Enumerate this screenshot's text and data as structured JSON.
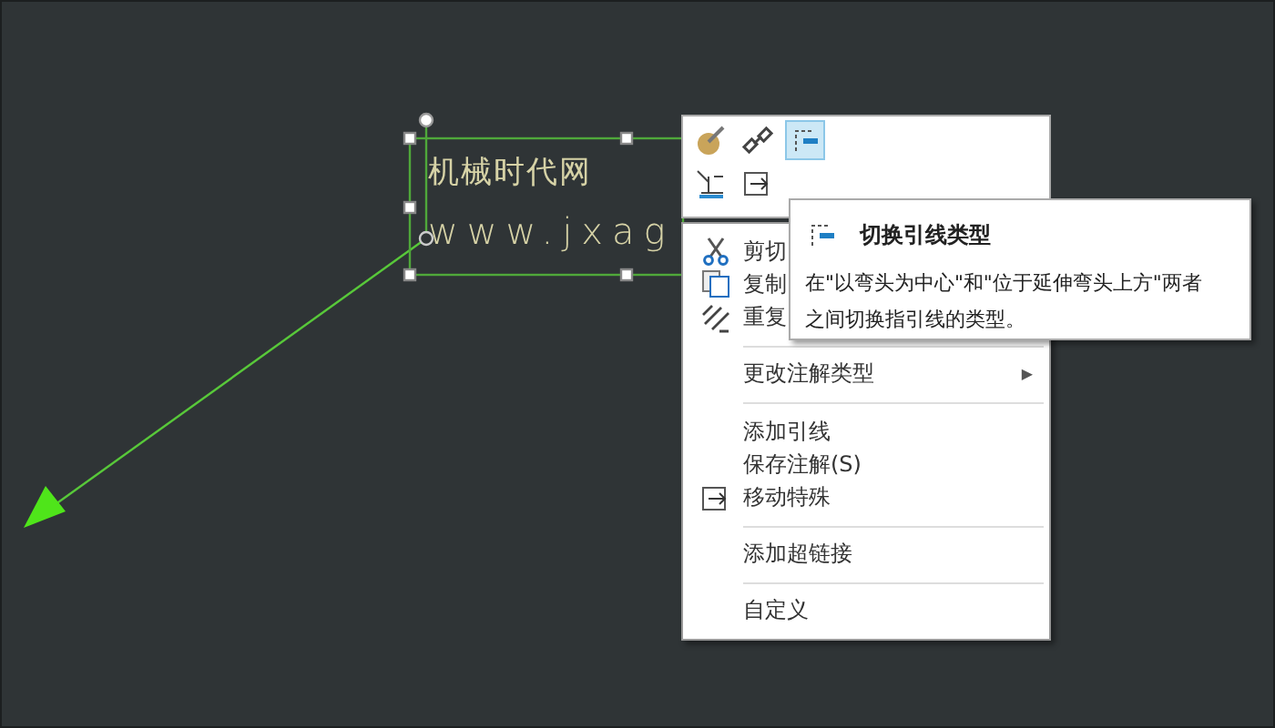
{
  "annotation": {
    "lines": [
      "机械时代网",
      "www.jxag"
    ]
  },
  "mini_toolbar": {
    "rows": [
      [
        {
          "selected": false
        },
        {
          "selected": false
        },
        {
          "selected": true
        }
      ],
      [
        {
          "selected": false
        },
        {
          "selected": false
        }
      ]
    ]
  },
  "context_menu": {
    "items": [
      {
        "kind": "item",
        "label": "剪切"
      },
      {
        "kind": "item",
        "label": "复制"
      },
      {
        "kind": "item",
        "label": "重复"
      },
      {
        "kind": "separator"
      },
      {
        "kind": "item",
        "label": "更改注解类型",
        "arrow": "▶"
      },
      {
        "kind": "separator"
      },
      {
        "kind": "item",
        "label": "添加引线"
      },
      {
        "kind": "item",
        "label": "保存注解(S)"
      },
      {
        "kind": "item",
        "label": "移动特殊"
      },
      {
        "kind": "separator"
      },
      {
        "kind": "item",
        "label": "添加超链接"
      },
      {
        "kind": "separator"
      },
      {
        "kind": "item",
        "label": "自定义"
      }
    ]
  },
  "tooltip": {
    "title": "切换引线类型",
    "body": [
      "在\"以弯头为中心\"和\"位于延伸弯头上方\"两者",
      "之间切换指引线的类型。"
    ]
  }
}
